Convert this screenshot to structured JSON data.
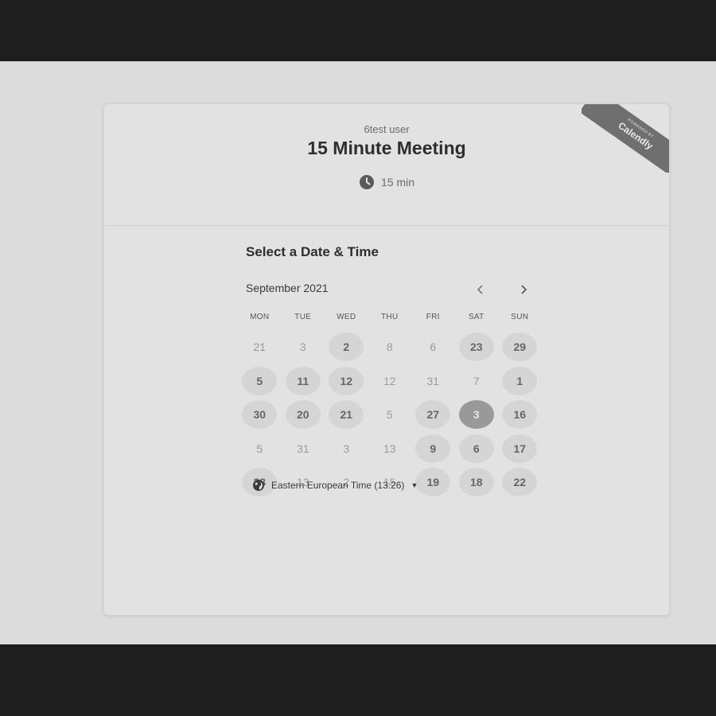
{
  "header": {
    "owner": "6test user",
    "event_title": "15 Minute Meeting",
    "duration": "15 min"
  },
  "ribbon": {
    "powered": "POWERED BY",
    "brand": "Calendly"
  },
  "calendar": {
    "heading": "Select a Date & Time",
    "month": "September 2021",
    "weekdays": [
      "MON",
      "TUE",
      "WED",
      "THU",
      "FRI",
      "SAT",
      "SUN"
    ],
    "days": [
      {
        "label": "21",
        "state": "disabled"
      },
      {
        "label": "3",
        "state": "disabled"
      },
      {
        "label": "2",
        "state": "available"
      },
      {
        "label": "8",
        "state": "disabled"
      },
      {
        "label": "6",
        "state": "disabled"
      },
      {
        "label": "23",
        "state": "available"
      },
      {
        "label": "29",
        "state": "available"
      },
      {
        "label": "5",
        "state": "available"
      },
      {
        "label": "11",
        "state": "available"
      },
      {
        "label": "12",
        "state": "available"
      },
      {
        "label": "12",
        "state": "disabled"
      },
      {
        "label": "31",
        "state": "disabled"
      },
      {
        "label": "7",
        "state": "disabled"
      },
      {
        "label": "1",
        "state": "available"
      },
      {
        "label": "30",
        "state": "available"
      },
      {
        "label": "20",
        "state": "available"
      },
      {
        "label": "21",
        "state": "available"
      },
      {
        "label": "5",
        "state": "disabled"
      },
      {
        "label": "27",
        "state": "available"
      },
      {
        "label": "3",
        "state": "selected"
      },
      {
        "label": "16",
        "state": "available"
      },
      {
        "label": "5",
        "state": "disabled"
      },
      {
        "label": "31",
        "state": "disabled"
      },
      {
        "label": "3",
        "state": "disabled"
      },
      {
        "label": "13",
        "state": "disabled"
      },
      {
        "label": "9",
        "state": "available"
      },
      {
        "label": "6",
        "state": "available"
      },
      {
        "label": "17",
        "state": "available"
      },
      {
        "label": "28",
        "state": "available"
      },
      {
        "label": "13",
        "state": "disabled"
      },
      {
        "label": "2",
        "state": "disabled"
      },
      {
        "label": "15",
        "state": "disabled"
      },
      {
        "label": "19",
        "state": "available"
      },
      {
        "label": "18",
        "state": "available"
      },
      {
        "label": "22",
        "state": "available"
      }
    ]
  },
  "timezone": {
    "label": "Eastern European Time (13:26)"
  },
  "icons": {
    "clock": "clock-icon",
    "prev": "chevron-left-icon",
    "next": "chevron-right-icon",
    "globe": "globe-icon",
    "caret": "caret-down-icon"
  },
  "colors": {
    "background": "#dcdcdc",
    "outer": "#1e1e1e",
    "selected": "#999999",
    "available": "#d5d5d5"
  }
}
